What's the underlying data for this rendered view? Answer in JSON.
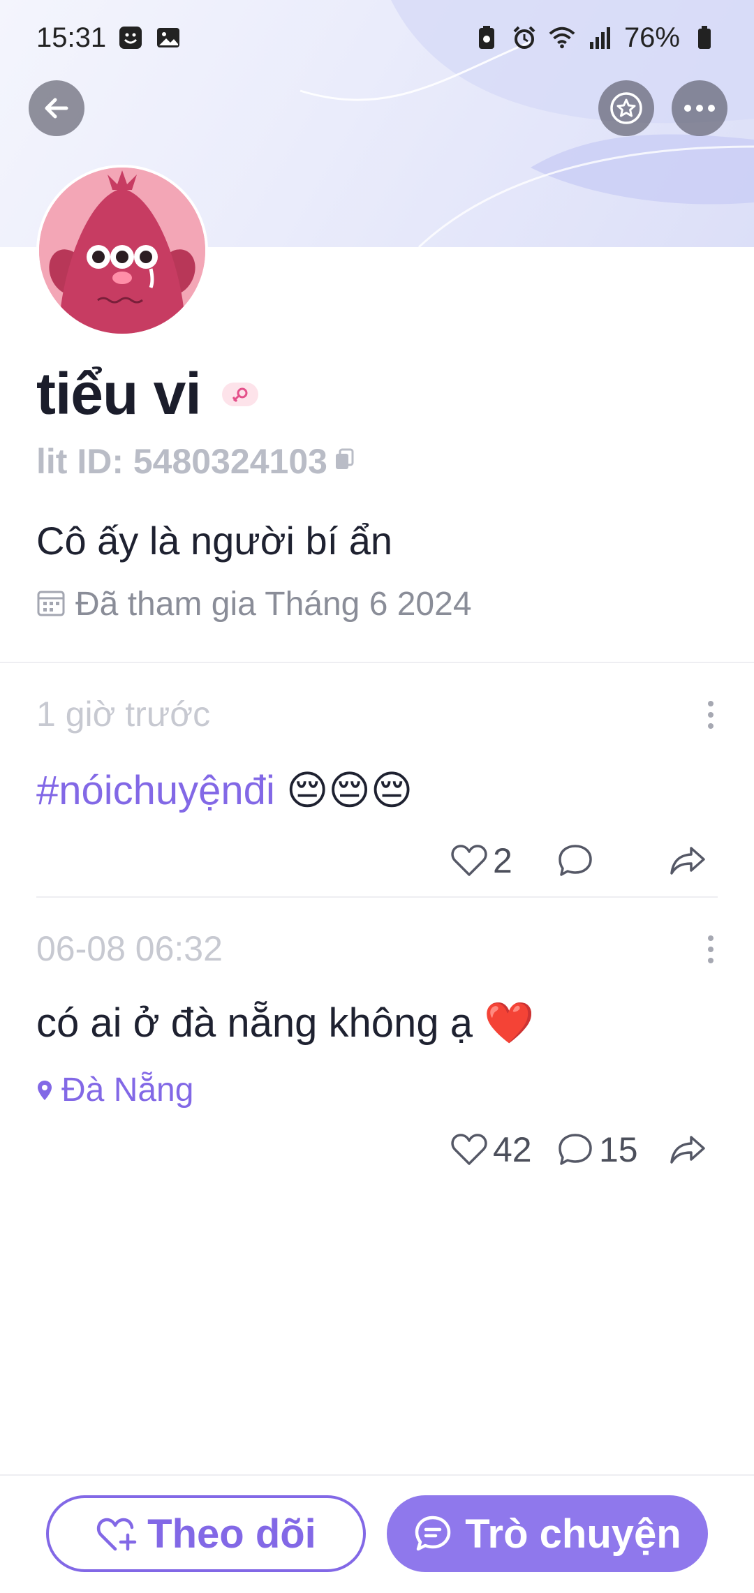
{
  "status_bar": {
    "time": "15:31",
    "battery": "76%"
  },
  "profile": {
    "name": "tiểu vi",
    "lit_id": "lit ID: 5480324103",
    "bio": "Cô ấy là người bí ẩn",
    "joined": "Đã tham gia Tháng 6 2024"
  },
  "posts": [
    {
      "time": "1 giờ trước",
      "hashtag": "#nóichuyệnđi",
      "text": " 😔😔😔",
      "likes": "2",
      "comments": ""
    },
    {
      "time": "06-08 06:32",
      "text": "có ai ở đà nẵng không ạ ❤️",
      "location": "Đà Nẵng",
      "likes": "42",
      "comments": "15"
    }
  ],
  "bottom_bar": {
    "follow_label": "Theo dõi",
    "chat_label": "Trò chuyện"
  },
  "icons": {
    "back": "arrow-left-icon",
    "favorite": "star-icon",
    "more": "more-horizontal-icon",
    "copy": "copy-icon",
    "calendar": "calendar-icon",
    "like": "heart-icon",
    "comment": "comment-icon",
    "share": "share-icon",
    "location": "location-pin-icon"
  },
  "colors": {
    "accent": "#8268e6",
    "accent_fill": "#8f78ec"
  }
}
